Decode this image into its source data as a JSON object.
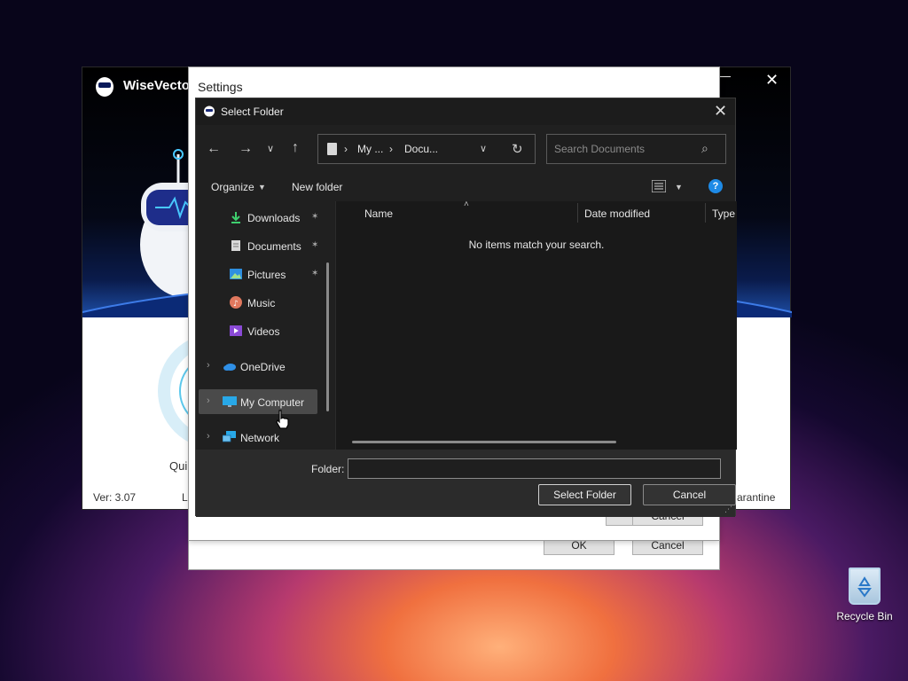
{
  "background_app": {
    "title": "WiseVector",
    "version": "Ver: 3.07",
    "quick_label": "Qui",
    "la_label": "La",
    "quarantine_label": "arantine",
    "max_glyph": "―",
    "close_glyph": "✕"
  },
  "settings_dialog": {
    "title": "Settings",
    "close_glyph": "✕",
    "ok_label": "OK",
    "cancel_label": "Cancel",
    "mid_ok_label": "OK",
    "mid_cancel_label": "Cancel"
  },
  "select_folder": {
    "title": "Select Folder",
    "close_glyph": "✕",
    "nav": {
      "back_glyph": "←",
      "forward_glyph": "→",
      "recent_glyph": "∨",
      "up_glyph": "↑"
    },
    "address": {
      "sep": "›",
      "part1": "My ...",
      "part2": "Docu...",
      "dropdown_glyph": "∨",
      "refresh_glyph": "↻"
    },
    "search": {
      "placeholder": "Search Documents",
      "icon_glyph": "⌕"
    },
    "toolbar": {
      "organize_label": "Organize",
      "caret": "▼",
      "new_folder_label": "New folder",
      "help_glyph": "?"
    },
    "nav_pane": {
      "items": [
        {
          "label": "Downloads",
          "pinned": true
        },
        {
          "label": "Documents",
          "pinned": true
        },
        {
          "label": "Pictures",
          "pinned": true
        },
        {
          "label": "Music",
          "pinned": false
        },
        {
          "label": "Videos",
          "pinned": false
        },
        {
          "label": "OneDrive",
          "expandable": true
        },
        {
          "label": "My Computer",
          "expandable": true,
          "selected": true
        },
        {
          "label": "Network",
          "expandable": true
        }
      ],
      "pin_glyph": "✶",
      "chevron_glyph": "›"
    },
    "columns": {
      "name": "Name",
      "sort_glyph": "˄",
      "date_modified": "Date modified",
      "type": "Type"
    },
    "empty_message": "No items match your search.",
    "folder_label": "Folder:",
    "folder_value": "",
    "select_button": "Select Folder",
    "cancel_button": "Cancel",
    "grip_glyph": "⋰"
  },
  "desktop": {
    "recycle_bin_label": "Recycle Bin"
  },
  "colors": {
    "dialog_bg": "#202020",
    "selected_item": "#4a4a4a",
    "help_blue": "#1e8ae6",
    "accent_cyan": "#1ea7e6"
  }
}
